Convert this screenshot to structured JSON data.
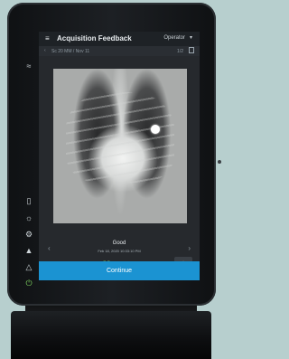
{
  "header": {
    "title": "Acquisition Feedback",
    "operator_label": "Operator"
  },
  "subbar": {
    "patient_info": "Sc 20 MM / Nov 11",
    "count": "1/2"
  },
  "result": {
    "label": "Good",
    "timestamp": "Feb 18, 2020 10:33:10 PM"
  },
  "actions": {
    "continue_label": "Continue"
  },
  "icons": {
    "menu": "hamburger-menu-icon",
    "back": "chevron-left-icon",
    "document": "document-icon",
    "prev": "chevron-left-icon",
    "next": "chevron-right-icon",
    "crop": "crop-icon",
    "rotate": "rotate-icon",
    "measure": "measure-icon",
    "view": "eye-icon"
  },
  "colors": {
    "accent": "#1b93d2",
    "tool_green": "#7ed35f",
    "background": "#b7cfce"
  }
}
